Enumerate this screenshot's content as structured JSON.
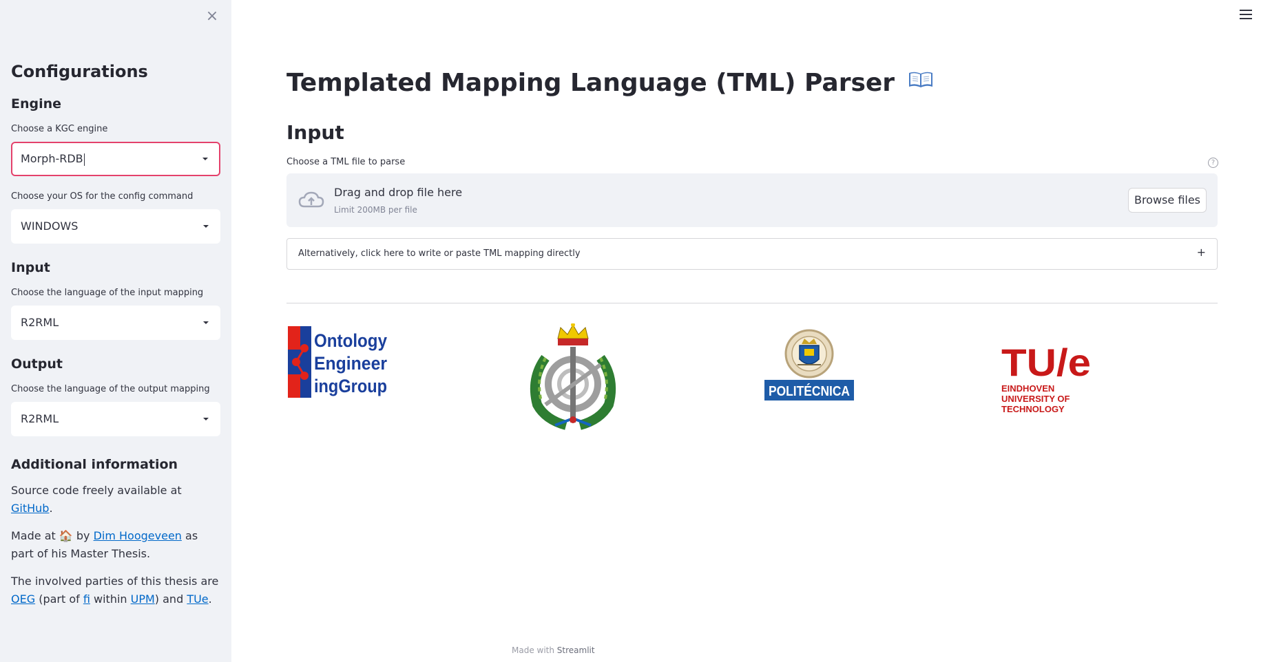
{
  "sidebar": {
    "title": "Configurations",
    "engine": {
      "header": "Engine",
      "engine_label": "Choose a KGC engine",
      "engine_value": "Morph-RDB",
      "os_label": "Choose your OS for the config command",
      "os_value": "WINDOWS"
    },
    "input": {
      "header": "Input",
      "label": "Choose the language of the input mapping",
      "value": "R2RML"
    },
    "output": {
      "header": "Output",
      "label": "Choose the language of the output mapping",
      "value": "R2RML"
    },
    "info": {
      "header": "Additional information",
      "p1_text": "Source code freely available at ",
      "p1_link": "GitHub",
      "p1_end": ".",
      "p2_text": "Made at ",
      "p2_emoji": "🏠",
      "p2_by": " by ",
      "p2_link": "Dim Hoogeveen",
      "p2_end": " as part of his Master Thesis.",
      "p3_text": "The involved parties of this thesis are ",
      "p3_link1": "OEG",
      "p3_mid1": " (part of ",
      "p3_link2": "fi",
      "p3_mid2": " within ",
      "p3_link3": "UPM",
      "p3_mid3": ") and ",
      "p3_link4": "TUe",
      "p3_end": "."
    }
  },
  "main": {
    "title": "Templated Mapping Language (TML) Parser",
    "title_icon": "open-book-icon",
    "subheader": "Input",
    "uploader": {
      "label": "Choose a TML file to parse",
      "help": "?",
      "drop_text": "Drag and drop file here",
      "limit_text": "Limit 200MB per file",
      "browse_label": "Browse files"
    },
    "expander": {
      "label": "Alternatively, click here to write or paste TML mapping directly",
      "toggle": "+"
    },
    "logos": {
      "oeg_lines": [
        "Ontology",
        "Engineer",
        "ingGroup"
      ],
      "upm_text": "POLITÉCNICA",
      "tue_mark": "TU/e",
      "tue_lines": [
        "EINDHOVEN",
        "UNIVERSITY OF",
        "TECHNOLOGY"
      ]
    }
  },
  "footer": {
    "prefix": "Made with ",
    "brand": "Streamlit"
  },
  "colors": {
    "sidebar_bg": "#f0f2f6",
    "focus_border": "#e4416b",
    "link": "#0068c9",
    "oeg_blue": "#1a3f9c",
    "oeg_red": "#e2231a",
    "upm_blue": "#1e5ca8",
    "tue_red": "#c81919"
  }
}
